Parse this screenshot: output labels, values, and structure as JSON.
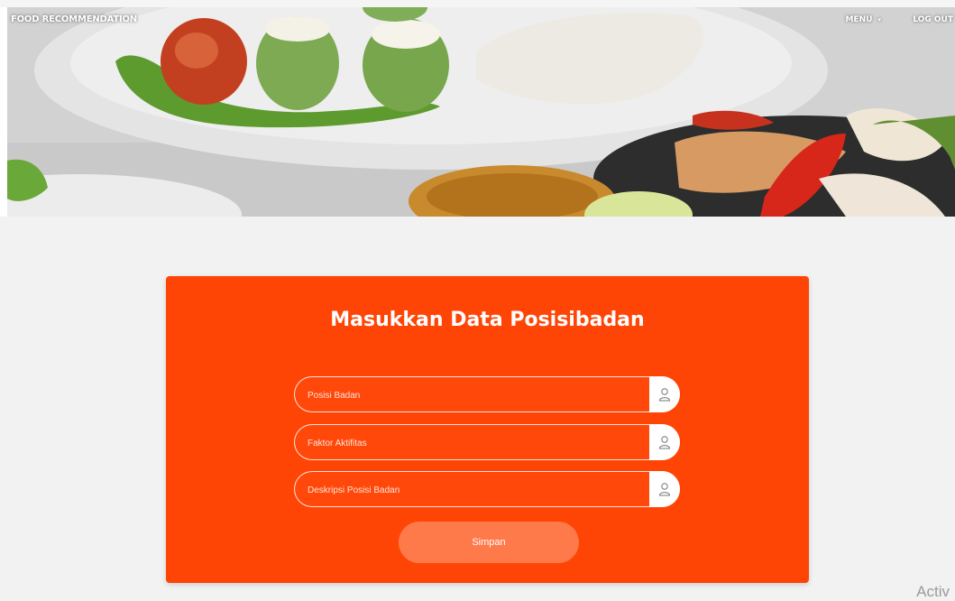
{
  "nav": {
    "brand": "FOOD RECOMMENDATION",
    "menu_label": "MENU",
    "logout_label": "LOG OUT"
  },
  "form": {
    "title": "Masukkan Data Posisibadan",
    "fields": [
      {
        "placeholder": "Posisi Badan",
        "icon": "user-icon"
      },
      {
        "placeholder": "Faktor Aktifitas",
        "icon": "user-icon"
      },
      {
        "placeholder": "Deskripsi Posisi Badan",
        "icon": "user-icon"
      }
    ],
    "submit_label": "Simpan"
  },
  "watermark": "Activ",
  "colors": {
    "card": "#ff4506",
    "button": "#ff7a4a",
    "background": "#f2f2f2"
  }
}
